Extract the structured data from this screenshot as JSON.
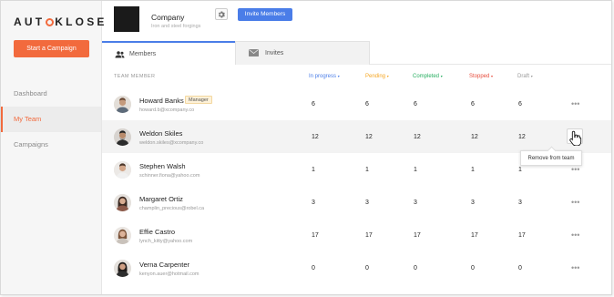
{
  "app": {
    "logo_left": "AUT",
    "logo_right": "KLOSE",
    "start_campaign": "Start a Campaign",
    "accent": "#f26a3d"
  },
  "sidebar": {
    "items": [
      {
        "label": "Dashboard",
        "active": false
      },
      {
        "label": "My Team",
        "active": true
      },
      {
        "label": "Campaigns",
        "active": false
      }
    ]
  },
  "header": {
    "company_name": "Company",
    "company_subtitle": "Iron and steel forgings",
    "invite_button": "Invite Members",
    "settings_icon": "gear-icon"
  },
  "tabs": [
    {
      "label": "Members",
      "icon": "people-icon",
      "active": true
    },
    {
      "label": "Invites",
      "icon": "envelope-icon",
      "active": false
    }
  ],
  "table": {
    "columns": {
      "member": "TEAM MEMBER",
      "in_progress": "In progress",
      "pending": "Pending",
      "completed": "Completed",
      "stopped": "Stopped",
      "draft": "Draft"
    },
    "column_colors": {
      "in_progress": "#4a7de8",
      "pending": "#f5a623",
      "completed": "#27ae60",
      "stopped": "#e74c3c",
      "draft": "#999999"
    },
    "rows": [
      {
        "name": "Howard Banks",
        "email": "howard.b@xcompany.co",
        "badge": "Manager",
        "in_progress": "6",
        "pending": "6",
        "completed": "6",
        "stopped": "6",
        "draft": "6"
      },
      {
        "name": "Weldon Skiles",
        "email": "weldon.skiles@xcompany.co",
        "in_progress": "12",
        "pending": "12",
        "completed": "12",
        "stopped": "12",
        "draft": "12"
      },
      {
        "name": "Stephen Walsh",
        "email": "schinner.fiona@yahoo.com",
        "in_progress": "1",
        "pending": "1",
        "completed": "1",
        "stopped": "1",
        "draft": "1"
      },
      {
        "name": "Margaret Ortiz",
        "email": "champlin_precious@robel.ca",
        "in_progress": "3",
        "pending": "3",
        "completed": "3",
        "stopped": "3",
        "draft": "3"
      },
      {
        "name": "Effie Castro",
        "email": "lynch_kitty@yahoo.com",
        "in_progress": "17",
        "pending": "17",
        "completed": "17",
        "stopped": "17",
        "draft": "17"
      },
      {
        "name": "Verna Carpenter",
        "email": "kenyon.auer@hotmail.com",
        "in_progress": "0",
        "pending": "0",
        "completed": "0",
        "stopped": "0",
        "draft": "0"
      }
    ],
    "more_label": "•••",
    "remove_tooltip": "Remove from team"
  }
}
